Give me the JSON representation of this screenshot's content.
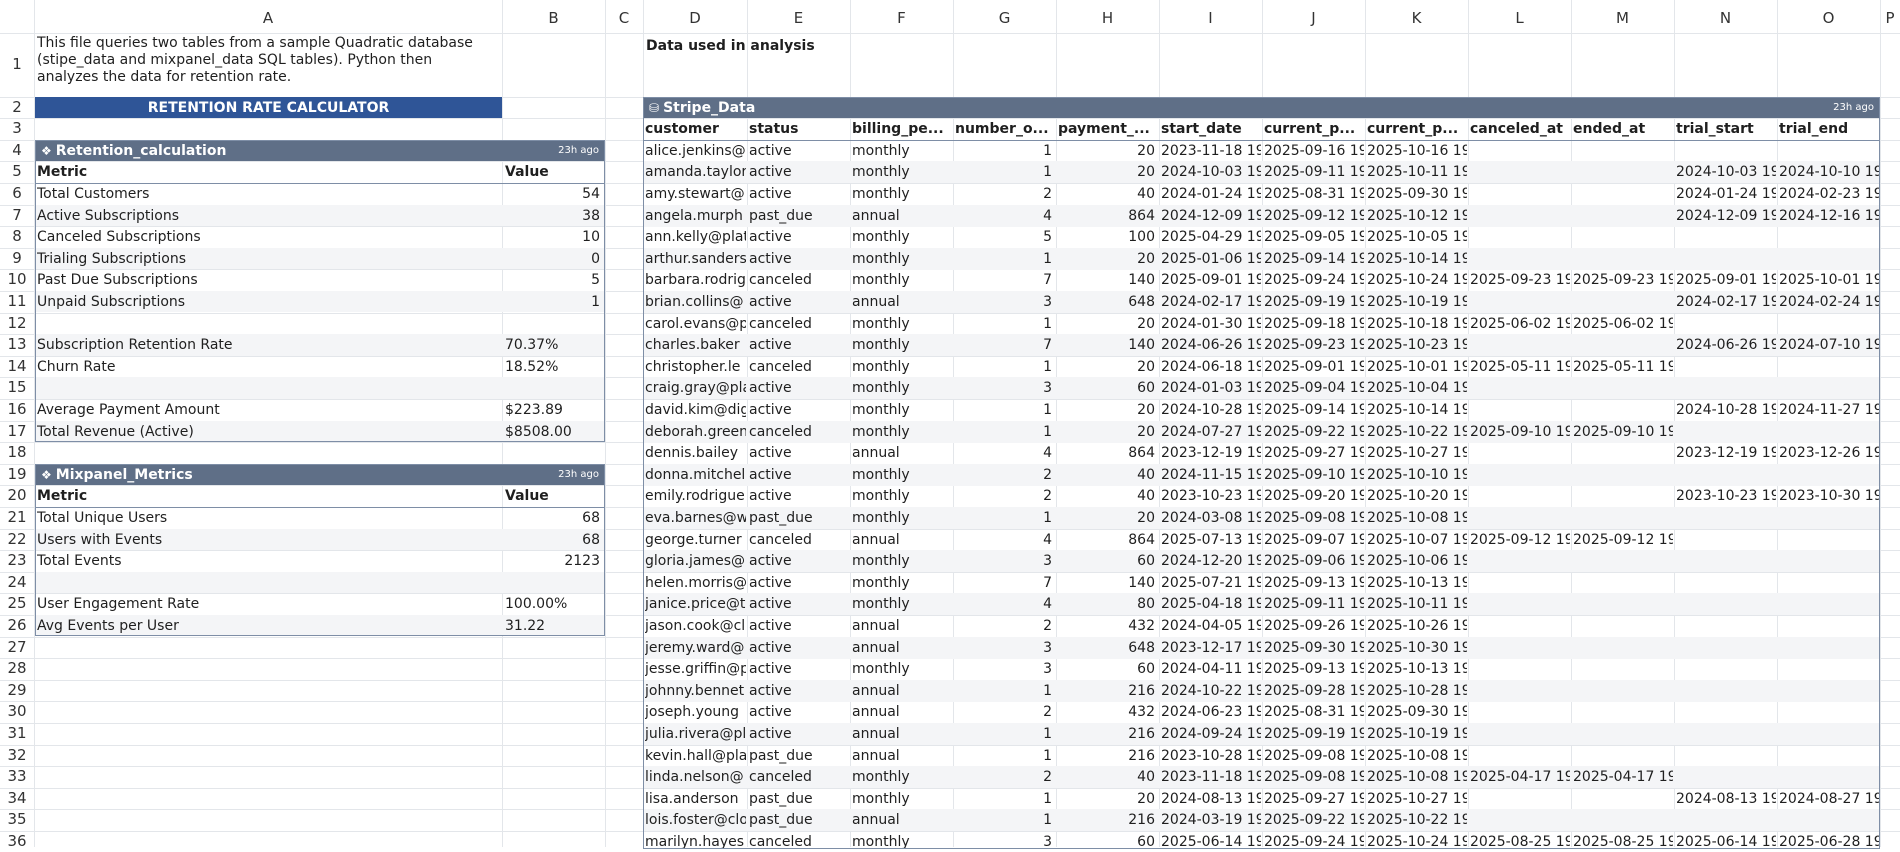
{
  "columns": [
    "A",
    "B",
    "C",
    "D",
    "E",
    "F",
    "G",
    "H",
    "I",
    "J",
    "K",
    "L",
    "M",
    "N",
    "O",
    "P"
  ],
  "rows": [
    "1",
    "2",
    "3",
    "4",
    "5",
    "6",
    "7",
    "8",
    "9",
    "10",
    "11",
    "12",
    "13",
    "14",
    "15",
    "16",
    "17",
    "18",
    "19",
    "20",
    "21",
    "22",
    "23",
    "24",
    "25",
    "26",
    "27",
    "28",
    "29",
    "30",
    "31",
    "32",
    "33",
    "34",
    "35",
    "36"
  ],
  "description": "This file queries two tables from a sample Quadratic database (stipe_data and mixpanel_data SQL tables). Python then analyzes the data for retention rate.",
  "data_label": "Data used in analysis",
  "calculator_title": "RETENTION RATE CALCULATOR",
  "icon_names": {
    "code": "code-cell-icon",
    "db": "database-icon"
  },
  "retention": {
    "name": "Retention_calculation",
    "ago": "23h ago",
    "headers": [
      "Metric",
      "Value"
    ],
    "rows": [
      [
        "Total Customers",
        "54"
      ],
      [
        "Active Subscriptions",
        "38"
      ],
      [
        "Canceled Subscriptions",
        "10"
      ],
      [
        "Trialing Subscriptions",
        "0"
      ],
      [
        "Past Due Subscriptions",
        "5"
      ],
      [
        "Unpaid Subscriptions",
        "1"
      ],
      [
        "",
        ""
      ],
      [
        "Subscription Retention Rate",
        "70.37%"
      ],
      [
        "Churn Rate",
        "18.52%"
      ],
      [
        "",
        ""
      ],
      [
        "Average Payment Amount",
        "$223.89"
      ],
      [
        "Total Revenue (Active)",
        "$8508.00"
      ]
    ]
  },
  "mixpanel": {
    "name": "Mixpanel_Metrics",
    "ago": "23h ago",
    "headers": [
      "Metric",
      "Value"
    ],
    "rows": [
      [
        "Total Unique Users",
        "68"
      ],
      [
        "Users with Events",
        "68"
      ],
      [
        "Total Events",
        "2123"
      ],
      [
        "",
        ""
      ],
      [
        "User Engagement Rate",
        "100.00%"
      ],
      [
        "Avg Events per User",
        "31.22"
      ]
    ]
  },
  "stripe": {
    "name": "Stripe_Data",
    "ago": "23h ago",
    "headers": [
      "customer",
      "status",
      "billing_pe...",
      "number_o...",
      "payment_...",
      "start_date",
      "current_p...",
      "current_p...",
      "canceled_at",
      "ended_at",
      "trial_start",
      "trial_end"
    ],
    "rows": [
      [
        "alice.jenkins@",
        "active",
        "monthly",
        "1",
        "20",
        "2023-11-18 19:",
        "2025-09-16 19:",
        "2025-10-16 19:",
        "",
        "",
        "",
        ""
      ],
      [
        "amanda.taylor",
        "active",
        "monthly",
        "1",
        "20",
        "2024-10-03 19:",
        "2025-09-11 19:",
        "2025-10-11 19:",
        "",
        "",
        "2024-10-03 19:",
        "2024-10-10 19:"
      ],
      [
        "amy.stewart@",
        "active",
        "monthly",
        "2",
        "40",
        "2024-01-24 19:",
        "2025-08-31 19:",
        "2025-09-30 19:",
        "",
        "",
        "2024-01-24 19:",
        "2024-02-23 19:"
      ],
      [
        "angela.murph",
        "past_due",
        "annual",
        "4",
        "864",
        "2024-12-09 19:",
        "2025-09-12 19:",
        "2025-10-12 19:",
        "",
        "",
        "2024-12-09 19:",
        "2024-12-16 19:"
      ],
      [
        "ann.kelly@plat",
        "active",
        "monthly",
        "5",
        "100",
        "2025-04-29 19:",
        "2025-09-05 19:",
        "2025-10-05 19:",
        "",
        "",
        "",
        ""
      ],
      [
        "arthur.sanders",
        "active",
        "monthly",
        "1",
        "20",
        "2025-01-06 19:",
        "2025-09-14 19:",
        "2025-10-14 19:",
        "",
        "",
        "",
        ""
      ],
      [
        "barbara.rodrig",
        "canceled",
        "monthly",
        "7",
        "140",
        "2025-09-01 19:",
        "2025-09-24 19:",
        "2025-10-24 19:",
        "2025-09-23 19:",
        "2025-09-23 19:",
        "2025-09-01 19:",
        "2025-10-01 19:"
      ],
      [
        "brian.collins@",
        "active",
        "annual",
        "3",
        "648",
        "2024-02-17 19:",
        "2025-09-19 19:",
        "2025-10-19 19:",
        "",
        "",
        "2024-02-17 19:",
        "2024-02-24 19:"
      ],
      [
        "carol.evans@pl",
        "canceled",
        "monthly",
        "1",
        "20",
        "2024-01-30 19:",
        "2025-09-18 19:",
        "2025-10-18 19:",
        "2025-06-02 19:",
        "2025-06-02 19:",
        "",
        ""
      ],
      [
        "charles.baker",
        "active",
        "monthly",
        "7",
        "140",
        "2024-06-26 19:",
        "2025-09-23 19:",
        "2025-10-23 19:",
        "",
        "",
        "2024-06-26 19:",
        "2024-07-10 19:"
      ],
      [
        "christopher.le",
        "canceled",
        "monthly",
        "1",
        "20",
        "2024-06-18 19:",
        "2025-09-01 19:",
        "2025-10-01 19:",
        "2025-05-11 19:",
        "2025-05-11 19:",
        "",
        ""
      ],
      [
        "craig.gray@pla",
        "active",
        "monthly",
        "3",
        "60",
        "2024-01-03 19:",
        "2025-09-04 19:",
        "2025-10-04 19:",
        "",
        "",
        "",
        ""
      ],
      [
        "david.kim@dig",
        "active",
        "monthly",
        "1",
        "20",
        "2024-10-28 19:",
        "2025-09-14 19:",
        "2025-10-14 19:",
        "",
        "",
        "2024-10-28 19:",
        "2024-11-27 19:"
      ],
      [
        "deborah.green",
        "canceled",
        "monthly",
        "1",
        "20",
        "2024-07-27 19:",
        "2025-09-22 19:",
        "2025-10-22 19:",
        "2025-09-10 19:",
        "2025-09-10 19:",
        "",
        ""
      ],
      [
        "dennis.bailey",
        "active",
        "annual",
        "4",
        "864",
        "2023-12-19 19:",
        "2025-09-27 19:",
        "2025-10-27 19:",
        "",
        "",
        "2023-12-19 19:",
        "2023-12-26 19:"
      ],
      [
        "donna.mitchell",
        "active",
        "monthly",
        "2",
        "40",
        "2024-11-15 19:",
        "2025-09-10 19:",
        "2025-10-10 19:",
        "",
        "",
        "",
        ""
      ],
      [
        "emily.rodrigue",
        "active",
        "monthly",
        "2",
        "40",
        "2023-10-23 19:",
        "2025-09-20 19:",
        "2025-10-20 19:",
        "",
        "",
        "2023-10-23 19:",
        "2023-10-30 19:"
      ],
      [
        "eva.barnes@w",
        "past_due",
        "monthly",
        "1",
        "20",
        "2024-03-08 19:",
        "2025-09-08 19:",
        "2025-10-08 19:",
        "",
        "",
        "",
        ""
      ],
      [
        "george.turner",
        "canceled",
        "annual",
        "4",
        "864",
        "2025-07-13 19:",
        "2025-09-07 19:",
        "2025-10-07 19:",
        "2025-09-12 19:",
        "2025-09-12 19:",
        "",
        ""
      ],
      [
        "gloria.james@",
        "active",
        "monthly",
        "3",
        "60",
        "2024-12-20 19:",
        "2025-09-06 19:",
        "2025-10-06 19:",
        "",
        "",
        "",
        ""
      ],
      [
        "helen.morris@",
        "active",
        "monthly",
        "7",
        "140",
        "2025-07-21 19:",
        "2025-09-13 19:",
        "2025-10-13 19:",
        "",
        "",
        "",
        ""
      ],
      [
        "janice.price@t",
        "active",
        "monthly",
        "4",
        "80",
        "2025-04-18 19:",
        "2025-09-11 19:",
        "2025-10-11 19:",
        "",
        "",
        "",
        ""
      ],
      [
        "jason.cook@cl",
        "active",
        "annual",
        "2",
        "432",
        "2024-04-05 19:",
        "2025-09-26 19:",
        "2025-10-26 19:",
        "",
        "",
        "",
        ""
      ],
      [
        "jeremy.ward@",
        "active",
        "annual",
        "3",
        "648",
        "2023-12-17 19:",
        "2025-09-30 19:",
        "2025-10-30 19:",
        "",
        "",
        "",
        ""
      ],
      [
        "jesse.griffin@p",
        "active",
        "monthly",
        "3",
        "60",
        "2024-04-11 19:",
        "2025-09-13 19:",
        "2025-10-13 19:",
        "",
        "",
        "",
        ""
      ],
      [
        "johnny.bennet",
        "active",
        "annual",
        "1",
        "216",
        "2024-10-22 19:",
        "2025-09-28 19:",
        "2025-10-28 19:",
        "",
        "",
        "",
        ""
      ],
      [
        "joseph.young",
        "active",
        "annual",
        "2",
        "432",
        "2024-06-23 19:",
        "2025-08-31 19:",
        "2025-09-30 19:",
        "",
        "",
        "",
        ""
      ],
      [
        "julia.rivera@pl",
        "active",
        "annual",
        "1",
        "216",
        "2024-09-24 19:",
        "2025-09-19 19:",
        "2025-10-19 19:",
        "",
        "",
        "",
        ""
      ],
      [
        "kevin.hall@pla",
        "past_due",
        "annual",
        "1",
        "216",
        "2023-10-28 19:",
        "2025-09-08 19:",
        "2025-10-08 19:",
        "",
        "",
        "",
        ""
      ],
      [
        "linda.nelson@",
        "canceled",
        "monthly",
        "2",
        "40",
        "2023-11-18 19:",
        "2025-09-08 19:",
        "2025-10-08 19:",
        "2025-04-17 19:",
        "2025-04-17 19:",
        "",
        ""
      ],
      [
        "lisa.anderson",
        "past_due",
        "monthly",
        "1",
        "20",
        "2024-08-13 19:",
        "2025-09-27 19:",
        "2025-10-27 19:",
        "",
        "",
        "2024-08-13 19:",
        "2024-08-27 19:"
      ],
      [
        "lois.foster@clo",
        "past_due",
        "annual",
        "1",
        "216",
        "2024-03-19 19:",
        "2025-09-22 19:",
        "2025-10-22 19:",
        "",
        "",
        "",
        ""
      ],
      [
        "marilyn.hayes",
        "canceled",
        "monthly",
        "3",
        "60",
        "2025-06-14 19:",
        "2025-09-24 19:",
        "2025-10-24 19:",
        "2025-08-25 19:",
        "2025-08-25 19:",
        "2025-06-14 19:",
        "2025-06-28 19:"
      ]
    ]
  }
}
